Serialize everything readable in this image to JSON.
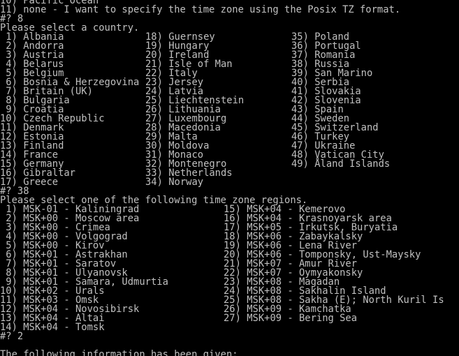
{
  "terminal": {
    "background": "#000000",
    "foreground": "#c0c0c0",
    "lines_top": [
      "10) Pacific Ocean",
      "11) none - I want to specify the time zone using the Posix TZ format.",
      "#? 8",
      "Please select a country."
    ],
    "countries": {
      "col1": [
        " 1) Albania",
        " 2) Andorra",
        " 3) Austria",
        " 4) Belarus",
        " 5) Belgium",
        " 6) Bosnia & Herzegovina",
        " 7) Britain (UK)",
        " 8) Bulgaria",
        " 9) Croatia",
        "10) Czech Republic",
        "11) Denmark",
        "12) Estonia",
        "13) Finland",
        "14) France",
        "15) Germany",
        "16) Gibraltar",
        "17) Greece"
      ],
      "col2": [
        "18) Guernsey",
        "19) Hungary",
        "20) Ireland",
        "21) Isle of Man",
        "22) Italy",
        "23) Jersey",
        "24) Latvia",
        "25) Liechtenstein",
        "26) Lithuania",
        "27) Luxembourg",
        "28) Macedonia",
        "29) Malta",
        "30) Moldova",
        "31) Monaco",
        "32) Montenegro",
        "33) Netherlands",
        "34) Norway"
      ],
      "col3": [
        "35) Poland",
        "36) Portugal",
        "37) Romania",
        "38) Russia",
        "39) San Marino",
        "40) Serbia",
        "41) Slovakia",
        "42) Slovenia",
        "43) Spain",
        "44) Sweden",
        "45) Switzerland",
        "46) Turkey",
        "47) Ukraine",
        "48) Vatican City",
        "49) Åland Islands"
      ]
    },
    "lines_mid": [
      "#? 38",
      "Please select one of the following time zone regions."
    ],
    "regions": {
      "col1": [
        " 1) MSK-01 - Kaliningrad",
        " 2) MSK+00 - Moscow area",
        " 3) MSK+00 - Crimea",
        " 4) MSK+00 - Volgograd",
        " 5) MSK+00 - Kirov",
        " 6) MSK+01 - Astrakhan",
        " 7) MSK+01 - Saratov",
        " 8) MSK+01 - Ulyanovsk",
        " 9) MSK+01 - Samara, Udmurtia",
        "10) MSK+02 - Urals",
        "11) MSK+03 - Omsk",
        "12) MSK+04 - Novosibirsk",
        "13) MSK+04 - Altai",
        "14) MSK+04 - Tomsk"
      ],
      "col2": [
        "15) MSK+04 - Kemerovo",
        "16) MSK+04 - Krasnoyarsk area",
        "17) MSK+05 - Irkutsk, Buryatia",
        "18) MSK+06 - Zabaykalsky",
        "19) MSK+06 - Lena River",
        "20) MSK+06 - Tomponsky, Ust-Maysky",
        "21) MSK+07 - Amur River",
        "22) MSK+07 - Oymyakonsky",
        "23) MSK+08 - Magadan",
        "24) MSK+08 - Sakhalin Island",
        "25) MSK+08 - Sakha (E); North Kuril Is",
        "26) MSK+09 - Kamchatka",
        "27) MSK+09 - Bering Sea"
      ]
    },
    "lines_bottom": [
      "#? 2",
      "",
      "The following information has been given:"
    ]
  }
}
